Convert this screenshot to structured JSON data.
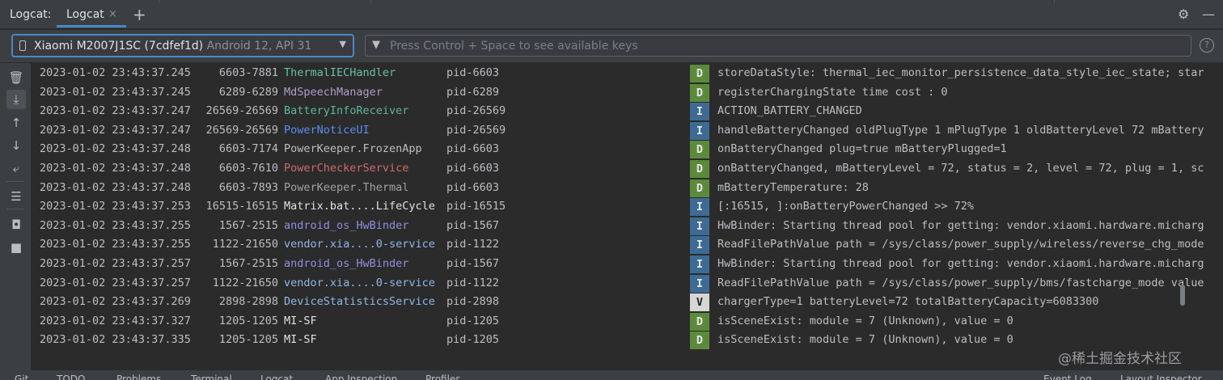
{
  "toolwindow": {
    "title": "Logcat:",
    "tab_label": "Logcat",
    "tab_close": "×",
    "add_tab": "+",
    "settings_icon": "gear-icon",
    "minimize_icon": "minimize-icon"
  },
  "filter": {
    "device_name": "Xiaomi M2007J1SC (7cdfef1d)",
    "device_api": "Android 12, API 31",
    "search_placeholder": "Press Control + Space to see available keys",
    "help": "?"
  },
  "sidebar_icons": [
    "trash-icon",
    "scroll-to-end-icon",
    "up-arrow-icon",
    "down-arrow-icon",
    "soft-wrap-icon",
    "filter-settings-icon",
    "camera-icon",
    "video-icon"
  ],
  "colors": {
    "level_D": "#5c8a3c",
    "level_I": "#3d6b93",
    "level_V": "#d6d6d6",
    "accent": "#4a88c7"
  },
  "rows": [
    {
      "date": "2023-01-02 23:43:37.245",
      "pid": "6603-7881",
      "tag": "ThermalIECHandler",
      "tag_color": "#67c0a8",
      "pkg": "pid-6603",
      "level": "D",
      "msg": "storeDataStyle: thermal_iec_monitor_persistence_data_style_iec_state; star"
    },
    {
      "date": "2023-01-02 23:43:37.245",
      "pid": "6289-6289",
      "tag": "MdSpeechManager",
      "tag_color": "#b59bd0",
      "pkg": "pid-6289",
      "level": "D",
      "msg": "registerChargingState time cost : 0"
    },
    {
      "date": "2023-01-02 23:43:37.247",
      "pid": "26569-26569",
      "tag": "BatteryInfoReceiver",
      "tag_color": "#5fb5a0",
      "pkg": "pid-26569",
      "level": "I",
      "msg": "ACTION_BATTERY_CHANGED"
    },
    {
      "date": "2023-01-02 23:43:37.247",
      "pid": "26569-26569",
      "tag": "PowerNoticeUI",
      "tag_color": "#5c8ef0",
      "pkg": "pid-26569",
      "level": "I",
      "msg": "handleBatteryChanged oldPlugType 1 mPlugType 1 oldBatteryLevel 72 mBattery"
    },
    {
      "date": "2023-01-02 23:43:37.248",
      "pid": "6603-7174",
      "tag": "PowerKeeper.FrozenApp",
      "tag_color": "#bcbec4",
      "pkg": "pid-6603",
      "level": "D",
      "msg": "onBatteryChanged plug=true mBatteryPlugged=1"
    },
    {
      "date": "2023-01-02 23:43:37.248",
      "pid": "6603-7610",
      "tag": "PowerCheckerService",
      "tag_color": "#d06a6a",
      "pkg": "pid-6603",
      "level": "D",
      "msg": "onBatteryChanged, mBatteryLevel = 72, status = 2, level = 72, plug = 1, sc"
    },
    {
      "date": "2023-01-02 23:43:37.248",
      "pid": "6603-7893",
      "tag": "PowerKeeper.Thermal",
      "tag_color": "#9fa2a7",
      "pkg": "pid-6603",
      "level": "D",
      "msg": "mBatteryTemperature: 28"
    },
    {
      "date": "2023-01-02 23:43:37.253",
      "pid": "16515-16515",
      "tag": "Matrix.bat....LifeCycle",
      "tag_color": "#dfe1e5",
      "pkg": "pid-16515",
      "level": "I",
      "msg": "[:16515, ]:onBatteryPowerChanged >> 72%"
    },
    {
      "date": "2023-01-02 23:43:37.255",
      "pid": "1567-2515",
      "tag": "android_os_HwBinder",
      "tag_color": "#8f8fe0",
      "pkg": "pid-1567",
      "level": "I",
      "msg": "HwBinder: Starting thread pool for getting: vendor.xiaomi.hardware.micharg"
    },
    {
      "date": "2023-01-02 23:43:37.255",
      "pid": "1122-21650",
      "tag": "vendor.xia....0-service",
      "tag_color": "#8fb8e8",
      "pkg": "pid-1122",
      "level": "I",
      "msg": "ReadFilePathValue path = /sys/class/power_supply/wireless/reverse_chg_mode"
    },
    {
      "date": "2023-01-02 23:43:37.257",
      "pid": "1567-2515",
      "tag": "android_os_HwBinder",
      "tag_color": "#8f8fe0",
      "pkg": "pid-1567",
      "level": "I",
      "msg": "HwBinder: Starting thread pool for getting: vendor.xiaomi.hardware.micharg"
    },
    {
      "date": "2023-01-02 23:43:37.257",
      "pid": "1122-21650",
      "tag": "vendor.xia....0-service",
      "tag_color": "#8fb8e8",
      "pkg": "pid-1122",
      "level": "I",
      "msg": "ReadFilePathValue path = /sys/class/power_supply/bms/fastcharge_mode value"
    },
    {
      "date": "2023-01-02 23:43:37.269",
      "pid": "2898-2898",
      "tag": "DeviceStatisticsService",
      "tag_color": "#8fb8e8",
      "pkg": "pid-2898",
      "level": "V",
      "msg": "chargerType=1 batteryLevel=72 totalBatteryCapacity=6083300"
    },
    {
      "date": "2023-01-02 23:43:37.327",
      "pid": "1205-1205",
      "tag": "MI-SF",
      "tag_color": "#dfe1e5",
      "pkg": "pid-1205",
      "level": "D",
      "msg": "isSceneExist: module = 7 (Unknown), value = 0"
    },
    {
      "date": "2023-01-02 23:43:37.335",
      "pid": "1205-1205",
      "tag": "MI-SF",
      "tag_color": "#dfe1e5",
      "pkg": "pid-1205",
      "level": "D",
      "msg": "isSceneExist: module = 7 (Unknown), value = 0"
    }
  ],
  "watermark": "@稀土掘金技术社区",
  "bottom_tabs": [
    "Git",
    "TODO",
    "Problems",
    "Terminal",
    "Logcat",
    "App Inspection",
    "Profiler",
    "Event Log",
    "Layout Inspector"
  ]
}
